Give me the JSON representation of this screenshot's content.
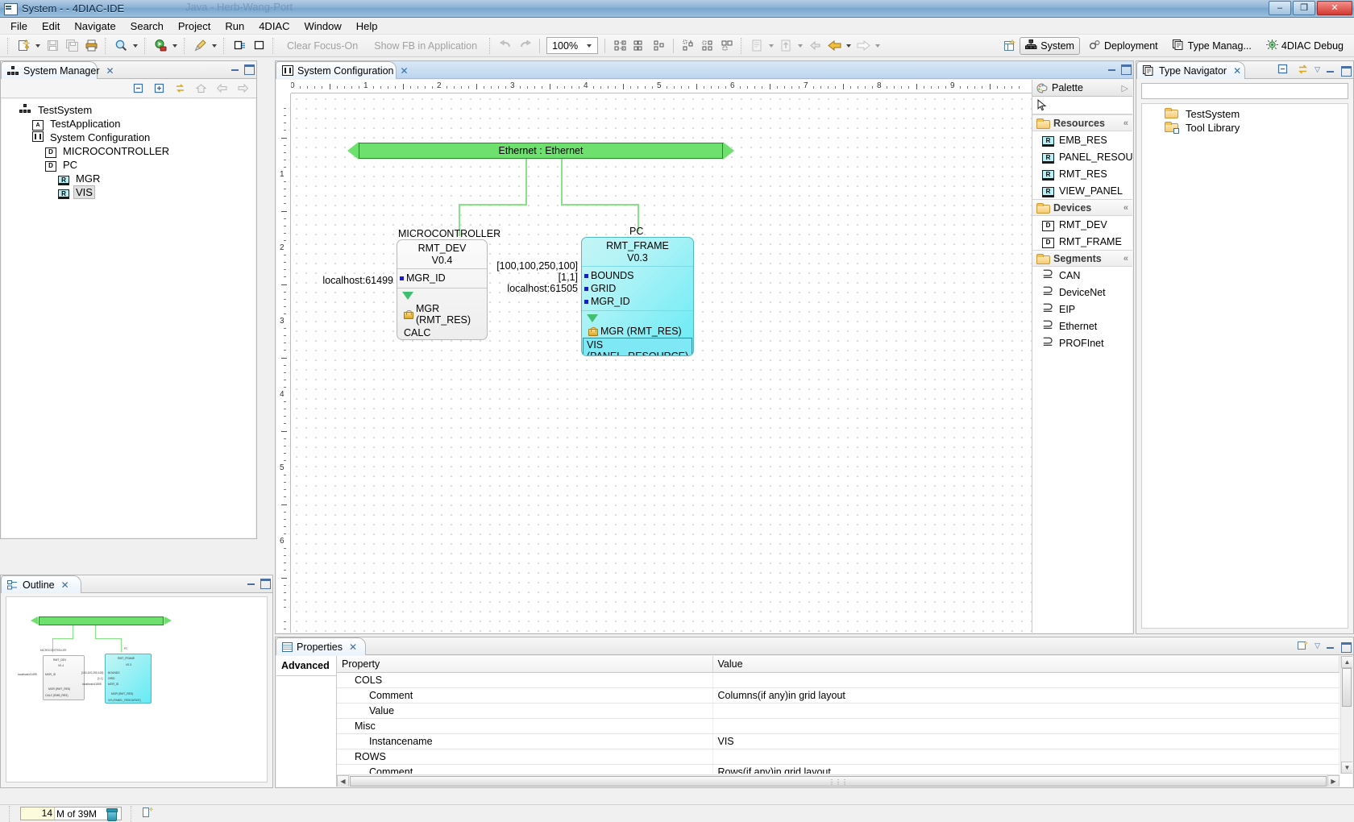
{
  "window": {
    "title": "System -  - 4DIAC-IDE",
    "ghost_title": "Java - Herb-Wang-Port",
    "minimize": "–",
    "maximize": "❐",
    "close": "✕"
  },
  "menu": [
    "File",
    "Edit",
    "Navigate",
    "Search",
    "Project",
    "Run",
    "4DIAC",
    "Window",
    "Help"
  ],
  "toolbar": {
    "clear_focus_on": "Clear Focus-On",
    "show_fb_in_application": "Show FB in Application",
    "zoom_value": "100%",
    "perspectives": [
      {
        "label": "System",
        "icon": "system-icon",
        "active": true
      },
      {
        "label": "Deployment",
        "icon": "deployment-icon",
        "active": false
      },
      {
        "label": "Type Manag...",
        "icon": "type-management-icon",
        "active": false
      },
      {
        "label": "4DIAC Debug",
        "icon": "debug-icon",
        "active": false
      }
    ]
  },
  "system_manager": {
    "tab_title": "System Manager",
    "tree": [
      {
        "label": "TestSystem",
        "icon": "system-icon",
        "indent": 0,
        "selected": false
      },
      {
        "label": "TestApplication",
        "icon": "application-icon",
        "indent": 1,
        "selected": false
      },
      {
        "label": "System Configuration",
        "icon": "configuration-icon",
        "indent": 1,
        "selected": false
      },
      {
        "label": "MICROCONTROLLER",
        "icon": "device-icon",
        "indent": 2,
        "selected": false
      },
      {
        "label": "PC",
        "icon": "device-icon",
        "indent": 2,
        "selected": false
      },
      {
        "label": "MGR",
        "icon": "resource-icon",
        "indent": 3,
        "selected": false
      },
      {
        "label": "VIS",
        "icon": "resource-icon",
        "indent": 3,
        "selected": true
      }
    ]
  },
  "outline": {
    "tab_title": "Outline"
  },
  "editor": {
    "tab_title": "System Configuration",
    "ruler_h": [
      "0",
      "1",
      "2",
      "3",
      "4",
      "5",
      "6",
      "7",
      "8",
      "9"
    ],
    "ruler_v": [
      "1",
      "2",
      "3",
      "4",
      "5",
      "6"
    ],
    "segment": {
      "name": "Ethernet : Ethernet"
    },
    "devices": [
      {
        "name": "MICROCONTROLLER",
        "type": "RMT_DEV",
        "version": "V0.4",
        "params": [
          {
            "label": "MGR_ID",
            "value": "localhost:61499"
          }
        ],
        "resources": [
          {
            "label": "MGR  (RMT_RES)",
            "locked": true,
            "selected": false
          },
          {
            "label": "CALC  (EMB_RES)",
            "locked": false,
            "selected": false
          }
        ]
      },
      {
        "name": "PC",
        "type": "RMT_FRAME",
        "version": "V0.3",
        "params": [
          {
            "label": "BOUNDS",
            "value": "[100,100,250,100]"
          },
          {
            "label": "GRID",
            "value": "[1,1]"
          },
          {
            "label": "MGR_ID",
            "value": "localhost:61505"
          }
        ],
        "resources": [
          {
            "label": "MGR  (RMT_RES)",
            "locked": true,
            "selected": false
          },
          {
            "label": "VIS  (PANEL_RESOURCE)",
            "locked": false,
            "selected": true
          }
        ]
      }
    ]
  },
  "palette": {
    "title": "Palette",
    "select_tool": "select-tool",
    "groups": [
      {
        "name": "Resources",
        "items": [
          {
            "label": "EMB_RES",
            "icon": "resource-icon"
          },
          {
            "label": "PANEL_RESOU...",
            "icon": "resource-icon"
          },
          {
            "label": "RMT_RES",
            "icon": "resource-icon"
          },
          {
            "label": "VIEW_PANEL",
            "icon": "resource-icon"
          }
        ]
      },
      {
        "name": "Devices",
        "items": [
          {
            "label": "RMT_DEV",
            "icon": "device-icon"
          },
          {
            "label": "RMT_FRAME",
            "icon": "device-icon"
          }
        ]
      },
      {
        "name": "Segments",
        "items": [
          {
            "label": "CAN",
            "icon": "segment-icon"
          },
          {
            "label": "DeviceNet",
            "icon": "segment-icon"
          },
          {
            "label": "EIP",
            "icon": "segment-icon"
          },
          {
            "label": "Ethernet",
            "icon": "segment-icon"
          },
          {
            "label": "PROFInet",
            "icon": "segment-icon"
          }
        ]
      }
    ]
  },
  "type_navigator": {
    "tab_title": "Type Navigator",
    "filter_value": "",
    "filter_placeholder": "",
    "tree": [
      {
        "label": "TestSystem",
        "icon": "folder-icon"
      },
      {
        "label": "Tool Library",
        "icon": "folder-library-icon"
      }
    ]
  },
  "properties": {
    "tab_title": "Properties",
    "side_tab": "Advanced",
    "columns": [
      "Property",
      "Value"
    ],
    "rows": [
      {
        "property": "COLS",
        "value": "",
        "indent": 1
      },
      {
        "property": "Comment",
        "value": "Columns(if any)in grid layout",
        "indent": 2
      },
      {
        "property": "Value",
        "value": "",
        "indent": 2
      },
      {
        "property": "Misc",
        "value": "",
        "indent": 1
      },
      {
        "property": "Instancename",
        "value": "VIS",
        "indent": 2
      },
      {
        "property": "ROWS",
        "value": "",
        "indent": 1
      },
      {
        "property": "Comment",
        "value": "Rows(if any)in grid layout",
        "indent": 2
      }
    ]
  },
  "statusbar": {
    "heap_used": "14",
    "heap_text": "M of 39M"
  }
}
